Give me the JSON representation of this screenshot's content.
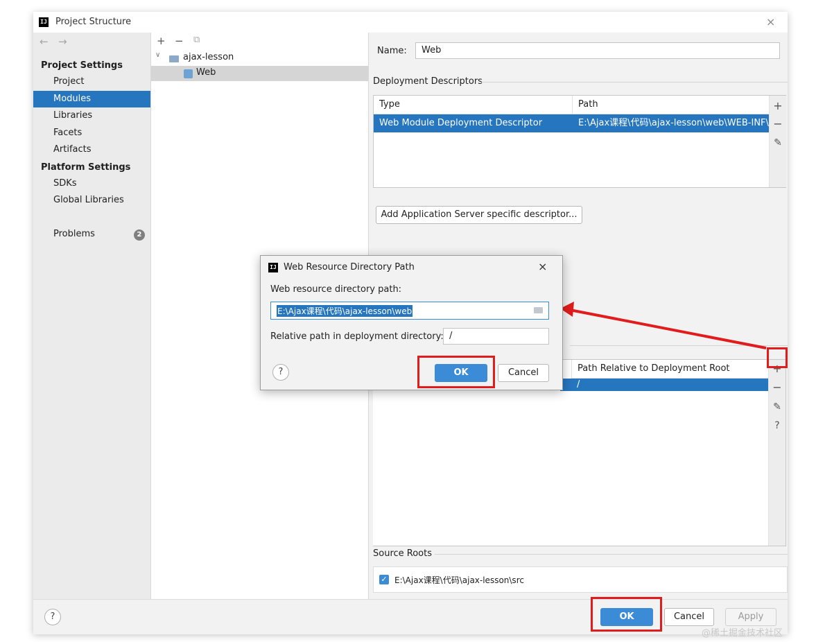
{
  "window": {
    "title": "Project Structure",
    "app_icon": "IJ",
    "close_glyph": "×"
  },
  "nav": {
    "back": "←",
    "forward": "→"
  },
  "sidebar": {
    "project_settings_header": "Project Settings",
    "project_items": [
      "Project",
      "Modules",
      "Libraries",
      "Facets",
      "Artifacts"
    ],
    "selected_item": "Modules",
    "platform_settings_header": "Platform Settings",
    "platform_items": [
      "SDKs",
      "Global Libraries"
    ],
    "problems": {
      "label": "Problems",
      "count": "2"
    }
  },
  "tree_toolbar": {
    "add": "+",
    "remove": "−",
    "copy": "⧉"
  },
  "tree": {
    "expand_glyph": "∨",
    "root": "ajax-lesson",
    "child": "Web"
  },
  "module": {
    "name_label": "Name:",
    "name_value": "Web",
    "deployment_descriptors": {
      "title": "Deployment Descriptors",
      "columns": [
        "Type",
        "Path"
      ],
      "rows": [
        {
          "type": "Web Module Deployment Descriptor",
          "path": "E:\\Ajax课程\\代码\\ajax-lesson\\web\\WEB-INF\\w"
        }
      ],
      "add_descriptor_button": "Add Application Server specific descriptor..."
    },
    "web_resource_dirs": {
      "column_path_relative": "Path Relative to Deployment Root",
      "row_relative": "/"
    },
    "source_roots": {
      "title": "Source Roots",
      "items": [
        {
          "checked": true,
          "path": "E:\\Ajax课程\\代码\\ajax-lesson\\src"
        }
      ]
    }
  },
  "side_tools": {
    "add": "+",
    "remove": "−",
    "edit": "✎",
    "help": "?"
  },
  "footer": {
    "help": "?",
    "ok": "OK",
    "cancel": "Cancel",
    "apply": "Apply"
  },
  "dialog": {
    "title": "Web Resource Directory Path",
    "path_label": "Web resource directory path:",
    "path_value": "E:\\Ajax课程\\代码\\ajax-lesson\\web",
    "relative_label": "Relative path in deployment directory:",
    "relative_value": "/",
    "ok": "OK",
    "cancel": "Cancel",
    "help": "?",
    "close_glyph": "×"
  },
  "watermark": "@稀土掘金技术社区",
  "colors": {
    "accent": "#2675bf",
    "annotation": "#e01c1c",
    "primary_button": "#3c8bd6"
  }
}
